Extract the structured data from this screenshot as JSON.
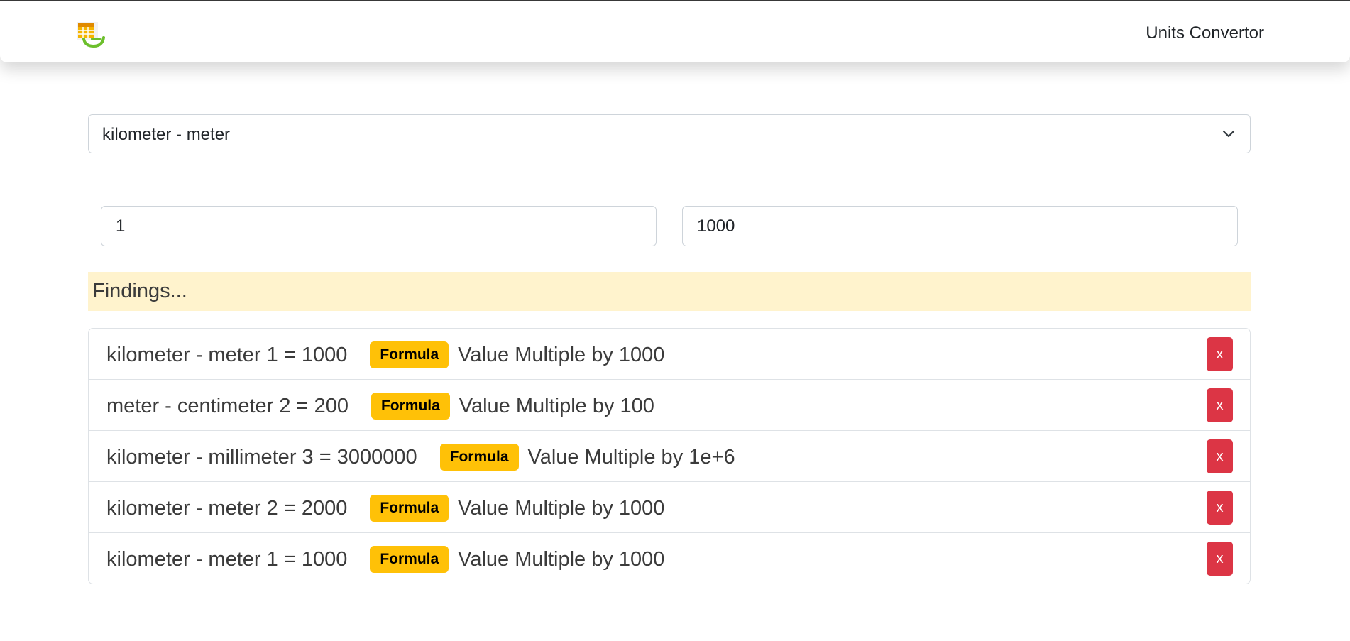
{
  "navbar": {
    "brand_link": "Units Convertor"
  },
  "converter": {
    "selected_conversion": "kilometer - meter",
    "from_value": "1",
    "to_value": "1000"
  },
  "findings": {
    "title": "Findings...",
    "items": [
      {
        "conversion": "kilometer - meter",
        "input": "1",
        "result": "1000",
        "badge": "Formula",
        "formula": "Value Multiple by 1000",
        "delete_label": "x"
      },
      {
        "conversion": "meter - centimeter",
        "input": "2",
        "result": "200",
        "badge": "Formula",
        "formula": "Value Multiple by 100",
        "delete_label": "x"
      },
      {
        "conversion": "kilometer - millimeter",
        "input": "3",
        "result": "3000000",
        "badge": "Formula",
        "formula": "Value Multiple by 1e+6",
        "delete_label": "x"
      },
      {
        "conversion": "kilometer - meter",
        "input": "2",
        "result": "2000",
        "badge": "Formula",
        "formula": "Value Multiple by 1000",
        "delete_label": "x"
      },
      {
        "conversion": "kilometer - meter",
        "input": "1",
        "result": "1000",
        "badge": "Formula",
        "formula": "Value Multiple by 1000",
        "delete_label": "x"
      }
    ]
  },
  "colors": {
    "badge": "#ffc107",
    "delete_button": "#dc3545",
    "findings_background": "#fff3cd"
  },
  "icons": {
    "logo": "spreadsheet-logo-icon",
    "select_arrow": "chevron-down-icon"
  }
}
